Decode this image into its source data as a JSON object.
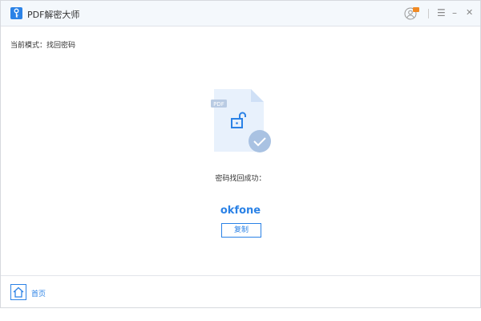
{
  "app": {
    "title": "PDF解密大师"
  },
  "window_controls": {
    "menu": "☰",
    "minimize": "–",
    "close": "✕"
  },
  "mode": {
    "text": "当前模式：找回密码"
  },
  "illustration": {
    "badge": "PDF"
  },
  "result": {
    "message": "密码找回成功：",
    "password": "okfone",
    "copy_label": "复制"
  },
  "footer": {
    "home_label": "首页"
  },
  "colors": {
    "accent": "#2b82e6",
    "vip": "#f08a24"
  }
}
